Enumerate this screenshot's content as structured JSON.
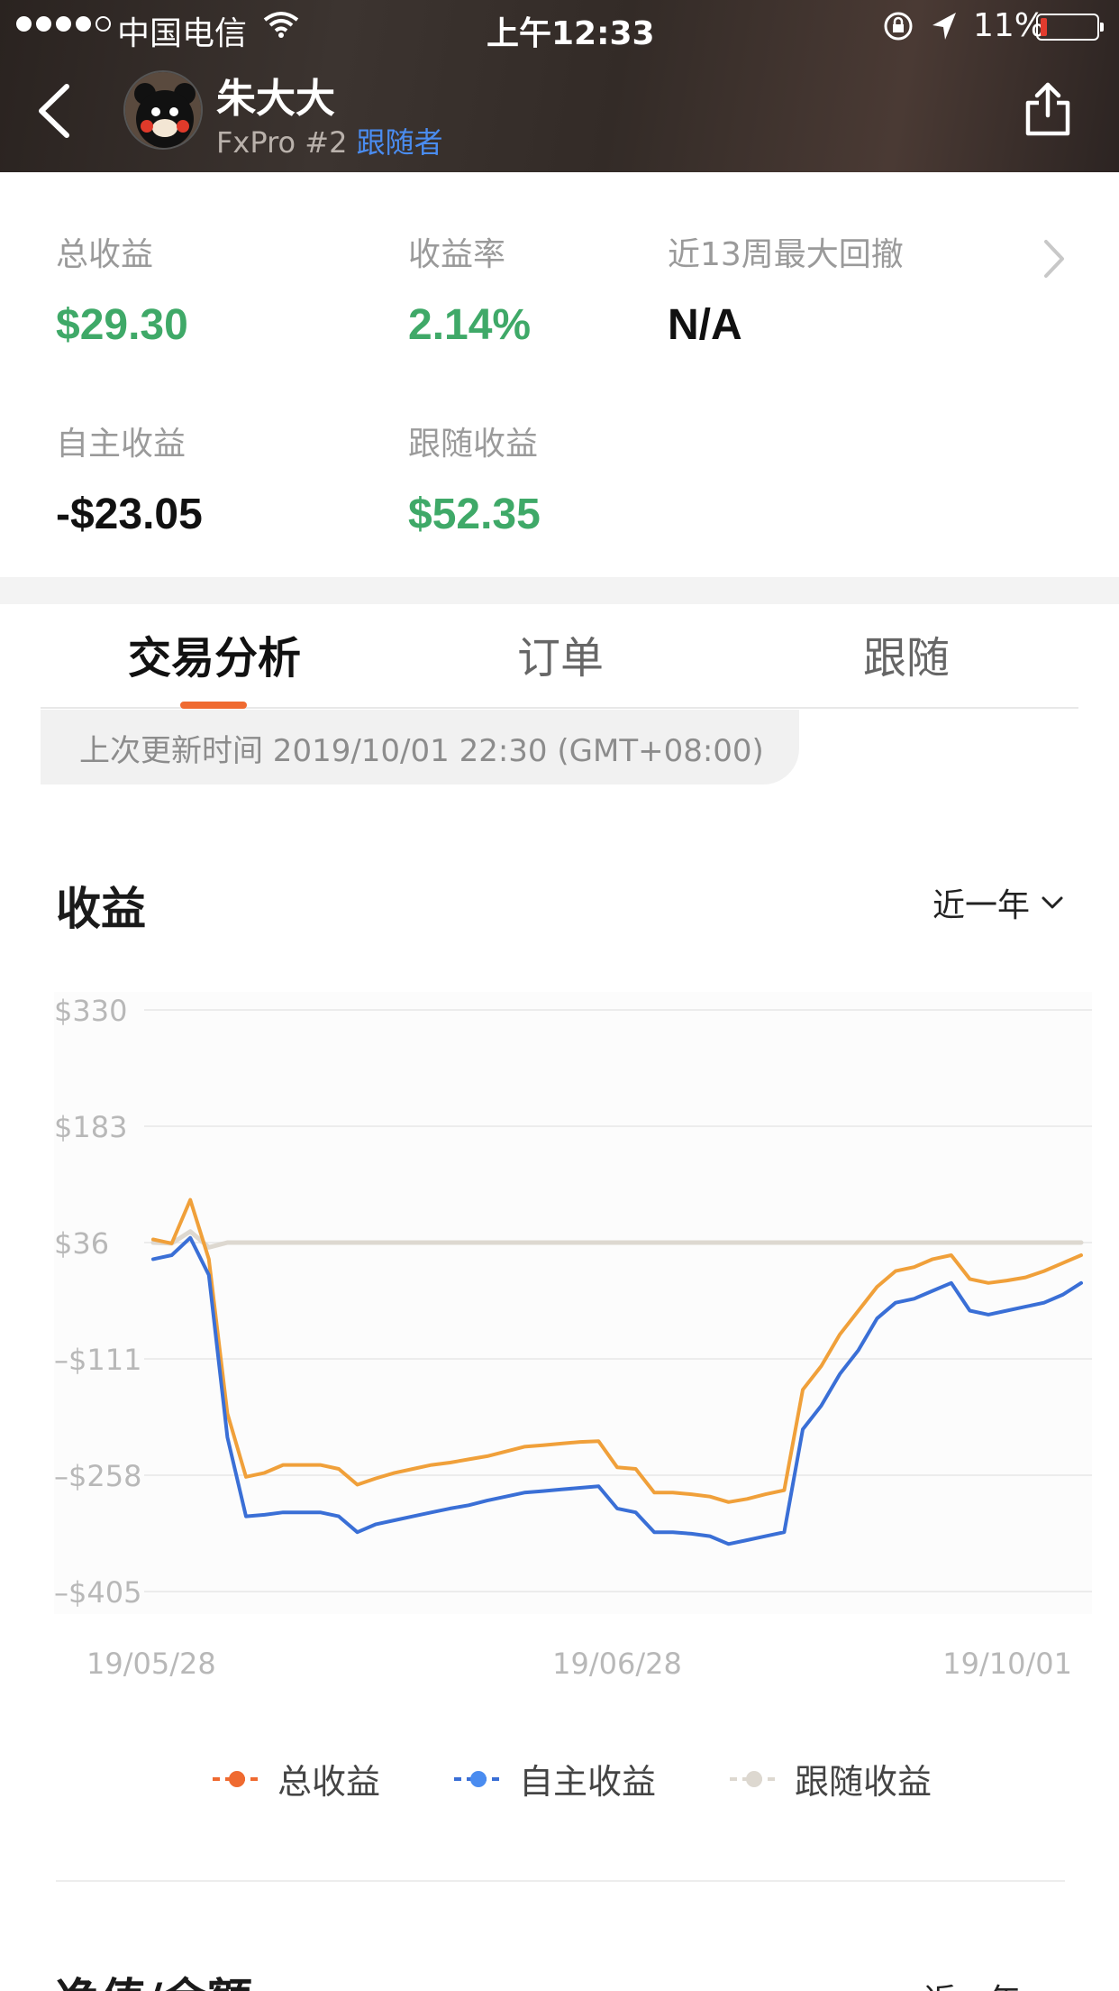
{
  "status_bar": {
    "carrier": "中国电信",
    "time": "上午12:33",
    "battery_percent": "11%",
    "battery_level": 0.11
  },
  "header": {
    "name": "朱大大",
    "broker": "FxPro #2",
    "role_badge": "跟随者",
    "back_icon": "chevron-left-icon",
    "share_icon": "share-icon"
  },
  "summary": {
    "total_profit_label": "总收益",
    "total_profit_value": "$29.30",
    "return_rate_label": "收益率",
    "return_rate_value": "2.14%",
    "drawdown_label": "近13周最大回撤",
    "drawdown_value": "N/A",
    "self_profit_label": "自主收益",
    "self_profit_value": "-$23.05",
    "follow_profit_label": "跟随收益",
    "follow_profit_value": "$52.35"
  },
  "tabs": [
    {
      "label": "交易分析",
      "active": true
    },
    {
      "label": "订单",
      "active": false
    },
    {
      "label": "跟随",
      "active": false
    }
  ],
  "update_text": "上次更新时间 2019/10/01 22:30 (GMT+08:00)",
  "chart_section": {
    "title": "收益",
    "range": "近一年"
  },
  "chart_data": {
    "type": "line",
    "title": "收益",
    "xlabel": "",
    "ylabel": "",
    "y_ticks": [
      "$330",
      "$183",
      "$36",
      "–$111",
      "–$258",
      "–$405"
    ],
    "y_tick_values": [
      330,
      183,
      36,
      -111,
      -258,
      -405
    ],
    "ylim": [
      -405,
      330
    ],
    "x_ticks": [
      "19/05/28",
      "19/06/28",
      "19/10/01"
    ],
    "x": [
      0,
      1,
      2,
      3,
      4,
      5,
      6,
      7,
      8,
      9,
      10,
      11,
      12,
      13,
      14,
      15,
      16,
      17,
      18,
      19,
      20,
      21,
      22,
      23,
      24,
      25,
      26,
      27,
      28,
      29,
      30,
      31,
      32,
      33,
      34,
      35,
      36,
      37,
      38,
      39,
      40,
      41,
      42,
      43,
      44,
      45,
      46,
      47,
      48,
      49,
      50
    ],
    "grid": true,
    "legend_position": "bottom",
    "series": [
      {
        "name": "总收益",
        "color": "#f0a03a",
        "values": [
          40,
          35,
          90,
          15,
          -180,
          -260,
          -255,
          -245,
          -245,
          -245,
          -250,
          -270,
          -262,
          -255,
          -250,
          -245,
          -242,
          -238,
          -234,
          -228,
          -222,
          -220,
          -218,
          -216,
          -215,
          -248,
          -250,
          -280,
          -280,
          -282,
          -285,
          -292,
          -288,
          -282,
          -277,
          -150,
          -120,
          -80,
          -50,
          -20,
          0,
          5,
          15,
          20,
          -10,
          -15,
          -12,
          -8,
          0,
          10,
          20
        ]
      },
      {
        "name": "自主收益",
        "color": "#3a6fd6",
        "values": [
          15,
          20,
          42,
          -5,
          -210,
          -310,
          -308,
          -305,
          -305,
          -305,
          -310,
          -330,
          -320,
          -315,
          -310,
          -305,
          -300,
          -296,
          -290,
          -285,
          -280,
          -278,
          -276,
          -274,
          -272,
          -300,
          -305,
          -330,
          -330,
          -332,
          -335,
          -345,
          -340,
          -335,
          -330,
          -200,
          -170,
          -130,
          -100,
          -60,
          -40,
          -35,
          -25,
          -15,
          -50,
          -55,
          -50,
          -45,
          -40,
          -30,
          -15
        ]
      },
      {
        "name": "跟随收益",
        "color": "#ddd8d0",
        "values": [
          36,
          35,
          50,
          30,
          36,
          36,
          36,
          36,
          36,
          36,
          36,
          36,
          36,
          36,
          36,
          36,
          36,
          36,
          36,
          36,
          36,
          36,
          36,
          36,
          36,
          36,
          36,
          36,
          36,
          36,
          36,
          36,
          36,
          36,
          36,
          36,
          36,
          36,
          36,
          36,
          36,
          36,
          36,
          36,
          36,
          36,
          36,
          36,
          36,
          36,
          36
        ]
      }
    ]
  },
  "legend": [
    {
      "label": "总收益",
      "color": "#ef6a30"
    },
    {
      "label": "自主收益",
      "color": "#3a6fd6"
    },
    {
      "label": "跟随收益",
      "color": "#ddd8d0"
    }
  ],
  "next_section": {
    "title": "净值/余额",
    "range": "近一年"
  }
}
